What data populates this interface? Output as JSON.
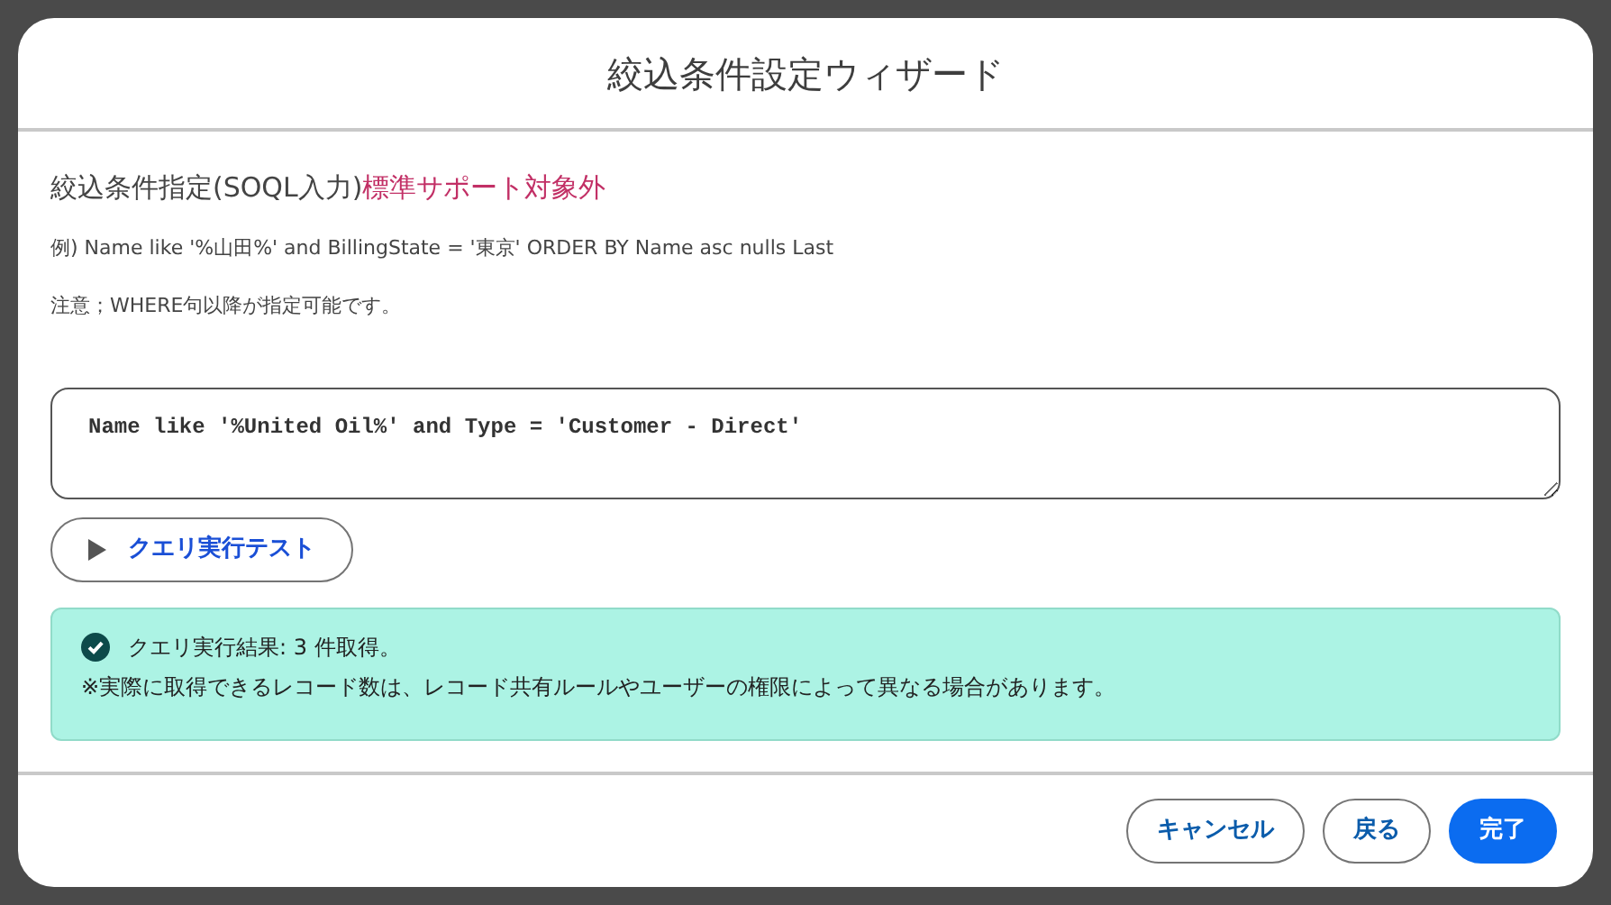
{
  "window": {
    "title": "絞込条件設定ウィザード"
  },
  "section": {
    "heading": "絞込条件指定(SOQL入力)",
    "heading_warning": "標準サポート対象外",
    "example": "例) Name like '%山田%' and BillingState = '東京' ORDER BY Name asc nulls Last",
    "note": "注意；WHERE句以降が指定可能です。"
  },
  "query": {
    "value": "Name like '%United Oil%' and Type = 'Customer - Direct'"
  },
  "test_button": {
    "label": "クエリ実行テスト"
  },
  "result": {
    "kind": "success",
    "lines": [
      "クエリ実行結果: 3 件取得。",
      "※実際に取得できるレコード数は、レコード共有ルールやユーザーの権限によって異なる場合があります。"
    ]
  },
  "buttons": [
    {
      "label": "キャンセル",
      "kind": "neutral"
    },
    {
      "label": "戻る",
      "kind": "neutral"
    },
    {
      "label": "完了",
      "kind": "brand"
    }
  ]
}
